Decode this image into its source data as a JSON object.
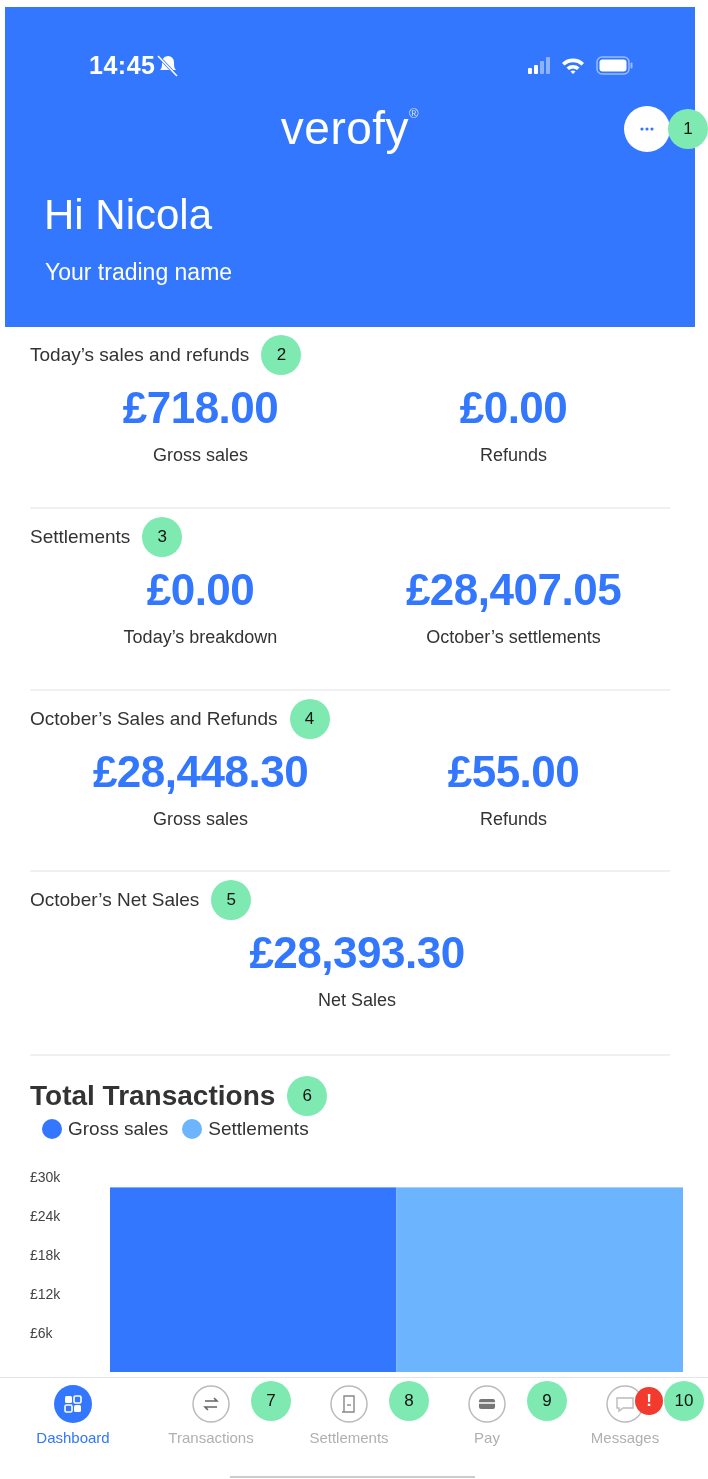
{
  "status_bar": {
    "time": "14:45"
  },
  "header": {
    "logo": "verofy$^{®}$",
    "callout": "1",
    "greeting": "Hi Nicola",
    "subtitle": "Your trading name"
  },
  "sections": [
    {
      "title": "Today’s sales and refunds",
      "callout": "2",
      "metrics": [
        {
          "value": "£718.00",
          "label": "Gross sales"
        },
        {
          "value": "£0.00",
          "label": "Refunds"
        }
      ]
    },
    {
      "title": "Settlements",
      "callout": "3",
      "metrics": [
        {
          "value": "£0.00",
          "label": "Today’s breakdown"
        },
        {
          "value": "£28,407.05",
          "label": "October’s settlements"
        }
      ]
    },
    {
      "title": "October’s Sales and Refunds",
      "callout": "4",
      "metrics": [
        {
          "value": "£28,448.30",
          "label": "Gross sales"
        },
        {
          "value": "£55.00",
          "label": "Refunds"
        }
      ]
    },
    {
      "title": "October’s Net Sales",
      "callout": "5",
      "metrics": [
        {
          "value": "£28,393.30",
          "label": "Net Sales"
        }
      ]
    }
  ],
  "chart": {
    "title": "Total Transactions",
    "callout": "6",
    "chart_data": {
      "type": "bar",
      "series": [
        {
          "name": "Gross sales",
          "color": "#3277fe",
          "values": [
            28400
          ]
        },
        {
          "name": "Settlements",
          "color": "#6cb4fd",
          "values": [
            28400
          ]
        }
      ],
      "ylim": [
        0,
        30000
      ],
      "yticks": [
        {
          "value": 6000,
          "label": "£6k"
        },
        {
          "value": 12000,
          "label": "£12k"
        },
        {
          "value": 18000,
          "label": "£18k"
        },
        {
          "value": 24000,
          "label": "£24k"
        },
        {
          "value": 30000,
          "label": "£30k"
        }
      ]
    }
  },
  "nav": [
    {
      "label": "Dashboard",
      "selected": true
    },
    {
      "label": "Transactions",
      "selected": false,
      "callout": "7"
    },
    {
      "label": "Settlements",
      "selected": false,
      "callout": "8"
    },
    {
      "label": "Pay",
      "selected": false,
      "callout": "9"
    },
    {
      "label": "Messages",
      "selected": false,
      "badge": "!",
      "callout": "10"
    }
  ]
}
